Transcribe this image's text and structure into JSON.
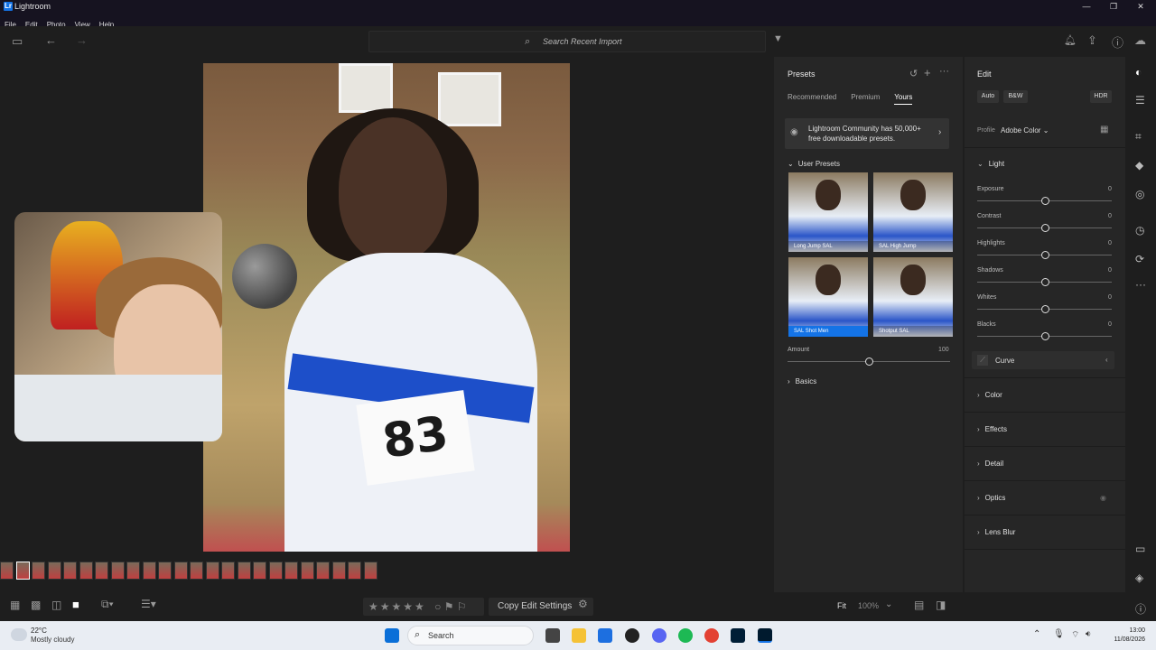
{
  "window": {
    "title": "Lightroom",
    "logo": "Lr",
    "minimize": "—",
    "restore": "❐",
    "close": "✕"
  },
  "menu": [
    "File",
    "Edit",
    "Photo",
    "View",
    "Help"
  ],
  "toolbar": {
    "search_placeholder": "Search Recent Import"
  },
  "presets": {
    "title": "Presets",
    "tabs": [
      "Recommended",
      "Premium",
      "Yours"
    ],
    "active_tab": "Yours",
    "community_text": "Lightroom Community has 50,000+ free downloadable presets.",
    "group": "User Presets",
    "tiles": [
      "Long Jump SAL",
      "SAL High Jump",
      "SAL Shot Men",
      "Shotput SAL"
    ],
    "amount_label": "Amount",
    "amount_value": "100",
    "amount_fraction": 0.5,
    "basics": "Basics"
  },
  "edit": {
    "title": "Edit",
    "auto": "Auto",
    "bw": "B&W",
    "hdr": "HDR",
    "profile_label": "Profile",
    "profile_value": "Adobe Color",
    "light": "Light",
    "sliders": [
      {
        "label": "Exposure",
        "value": "0"
      },
      {
        "label": "Contrast",
        "value": "0"
      },
      {
        "label": "Highlights",
        "value": "0"
      },
      {
        "label": "Shadows",
        "value": "0"
      },
      {
        "label": "Whites",
        "value": "0"
      },
      {
        "label": "Blacks",
        "value": "0"
      }
    ],
    "curve": "Curve",
    "sections": [
      "Color",
      "Effects",
      "Detail",
      "Optics",
      "Lens Blur"
    ]
  },
  "photo": {
    "bib_number": "83"
  },
  "bottombar": {
    "stars": "★★★★★",
    "copy_edit": "Copy Edit Settings",
    "fit": "Fit",
    "zoom": "100%"
  },
  "taskbar": {
    "temperature": "22°C",
    "weather": "Mostly cloudy",
    "search": "Search",
    "time": "13:00",
    "date": "11/08/2026"
  },
  "colors": {
    "accent": "#1473e6",
    "panel": "#262626",
    "background": "#1e1e1e"
  }
}
